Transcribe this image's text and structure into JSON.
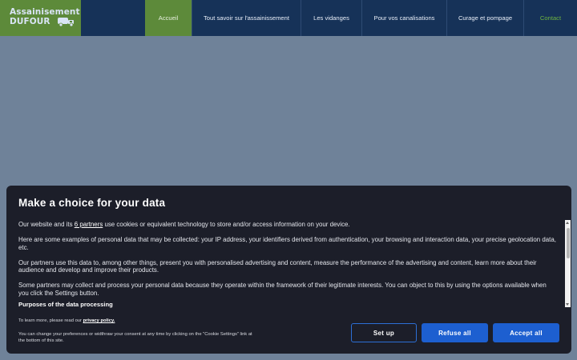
{
  "header": {
    "logo": {
      "line1": "Assainisement",
      "line2": "DUFOUR",
      "icon": "truck-icon"
    },
    "nav": [
      {
        "label": "Accueil",
        "active": true
      },
      {
        "label": "Tout savoir sur l'assainissement"
      },
      {
        "label": "Les vidanges"
      },
      {
        "label": "Pour vos canalisations"
      },
      {
        "label": "Curage et pompage"
      },
      {
        "label": "Contact"
      }
    ],
    "colors": {
      "bar": "#163258",
      "accent": "#5d8a3a",
      "contact": "#6db33f"
    }
  },
  "consent": {
    "title": "Make a choice for your data",
    "intro_before": "Our website and its ",
    "partners_link": "6 partners",
    "intro_after": " use cookies or equivalent technology to store and/or access information on your device.",
    "paragraph2": "Here are some examples of personal data that may be collected: your IP address, your identifiers derived from authentication, your browsing and interaction data, your precise geolocation data, etc.",
    "paragraph3": "Our partners use this data to, among other things, present you with personalised advertising and content, measure the performance of the advertising and content, learn more about their audience and develop and improve their products.",
    "paragraph4": "Some partners may collect and process your personal data because they operate within the framework of their legitimate interests. You can object to this by using the options available when you click the Settings button.",
    "purposes_heading": "Purposes of the data processing",
    "learn_more_prefix": "To learn more, please read our ",
    "privacy_link": "privacy policy.",
    "change_text": "You can change your preferences or widthraw your consent at any time by clicking on the \"Cookie Settings\" link at the bottom of this site.",
    "buttons": {
      "setup": "Set up",
      "refuse": "Refuse all",
      "accept": "Accept all"
    },
    "colors": {
      "panel": "#1c1e29",
      "primary": "#1d5fd0"
    }
  }
}
